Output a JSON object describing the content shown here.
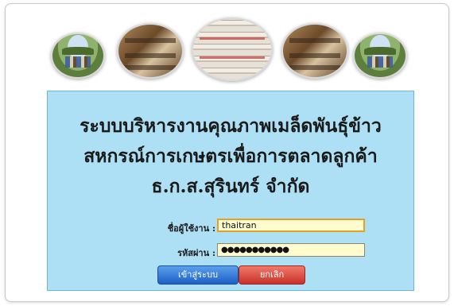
{
  "banner": {
    "photos": [
      "rice-field-group-photo",
      "mill-machinery-photo",
      "rice-sacks-photo",
      "mill-machinery-photo",
      "rice-field-group-photo"
    ]
  },
  "login_panel": {
    "title_line1": "ระบบบริหารงานคุณภาพเมล็ดพันธุ์ข้าว",
    "title_line2": "สหกรณ์การเกษตรเพื่อการตลาดลูกค้า",
    "title_line3": "ธ.ก.ส.สุรินทร์ จำกัด",
    "username_label": "ชื่อผู้ใช้งาน :",
    "username_value": "thaitran",
    "password_label": "รหัสผ่าน :",
    "password_value": "●●●●●●●●●●●",
    "login_button": "เข้าสู่ระบบ",
    "cancel_button": "ยกเลิก"
  },
  "colors": {
    "panel_background": "#ade0f4",
    "input_background": "#fffbd0",
    "login_button": "#2f74d6",
    "cancel_button": "#d9443a"
  }
}
